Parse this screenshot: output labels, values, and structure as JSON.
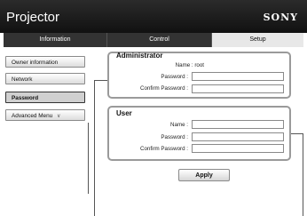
{
  "app": {
    "title": "Projector",
    "brand": "SONY"
  },
  "tabs": [
    {
      "label": "Information"
    },
    {
      "label": "Control"
    },
    {
      "label": "Setup"
    }
  ],
  "sidebar": {
    "items": [
      {
        "label": "Owner information"
      },
      {
        "label": "Network"
      },
      {
        "label": "Password"
      },
      {
        "label": "Advanced Menu"
      }
    ]
  },
  "administrator": {
    "title": "Administrator",
    "name_label": "Name : root",
    "password_label": "Password :",
    "confirm_label": "Confirm Password :",
    "password_value": "",
    "confirm_value": ""
  },
  "user": {
    "title": "User",
    "name_label": "Name :",
    "password_label": "Password :",
    "confirm_label": "Confirm Password :",
    "name_value": "",
    "password_value": "",
    "confirm_value": ""
  },
  "actions": {
    "apply_label": "Apply"
  }
}
